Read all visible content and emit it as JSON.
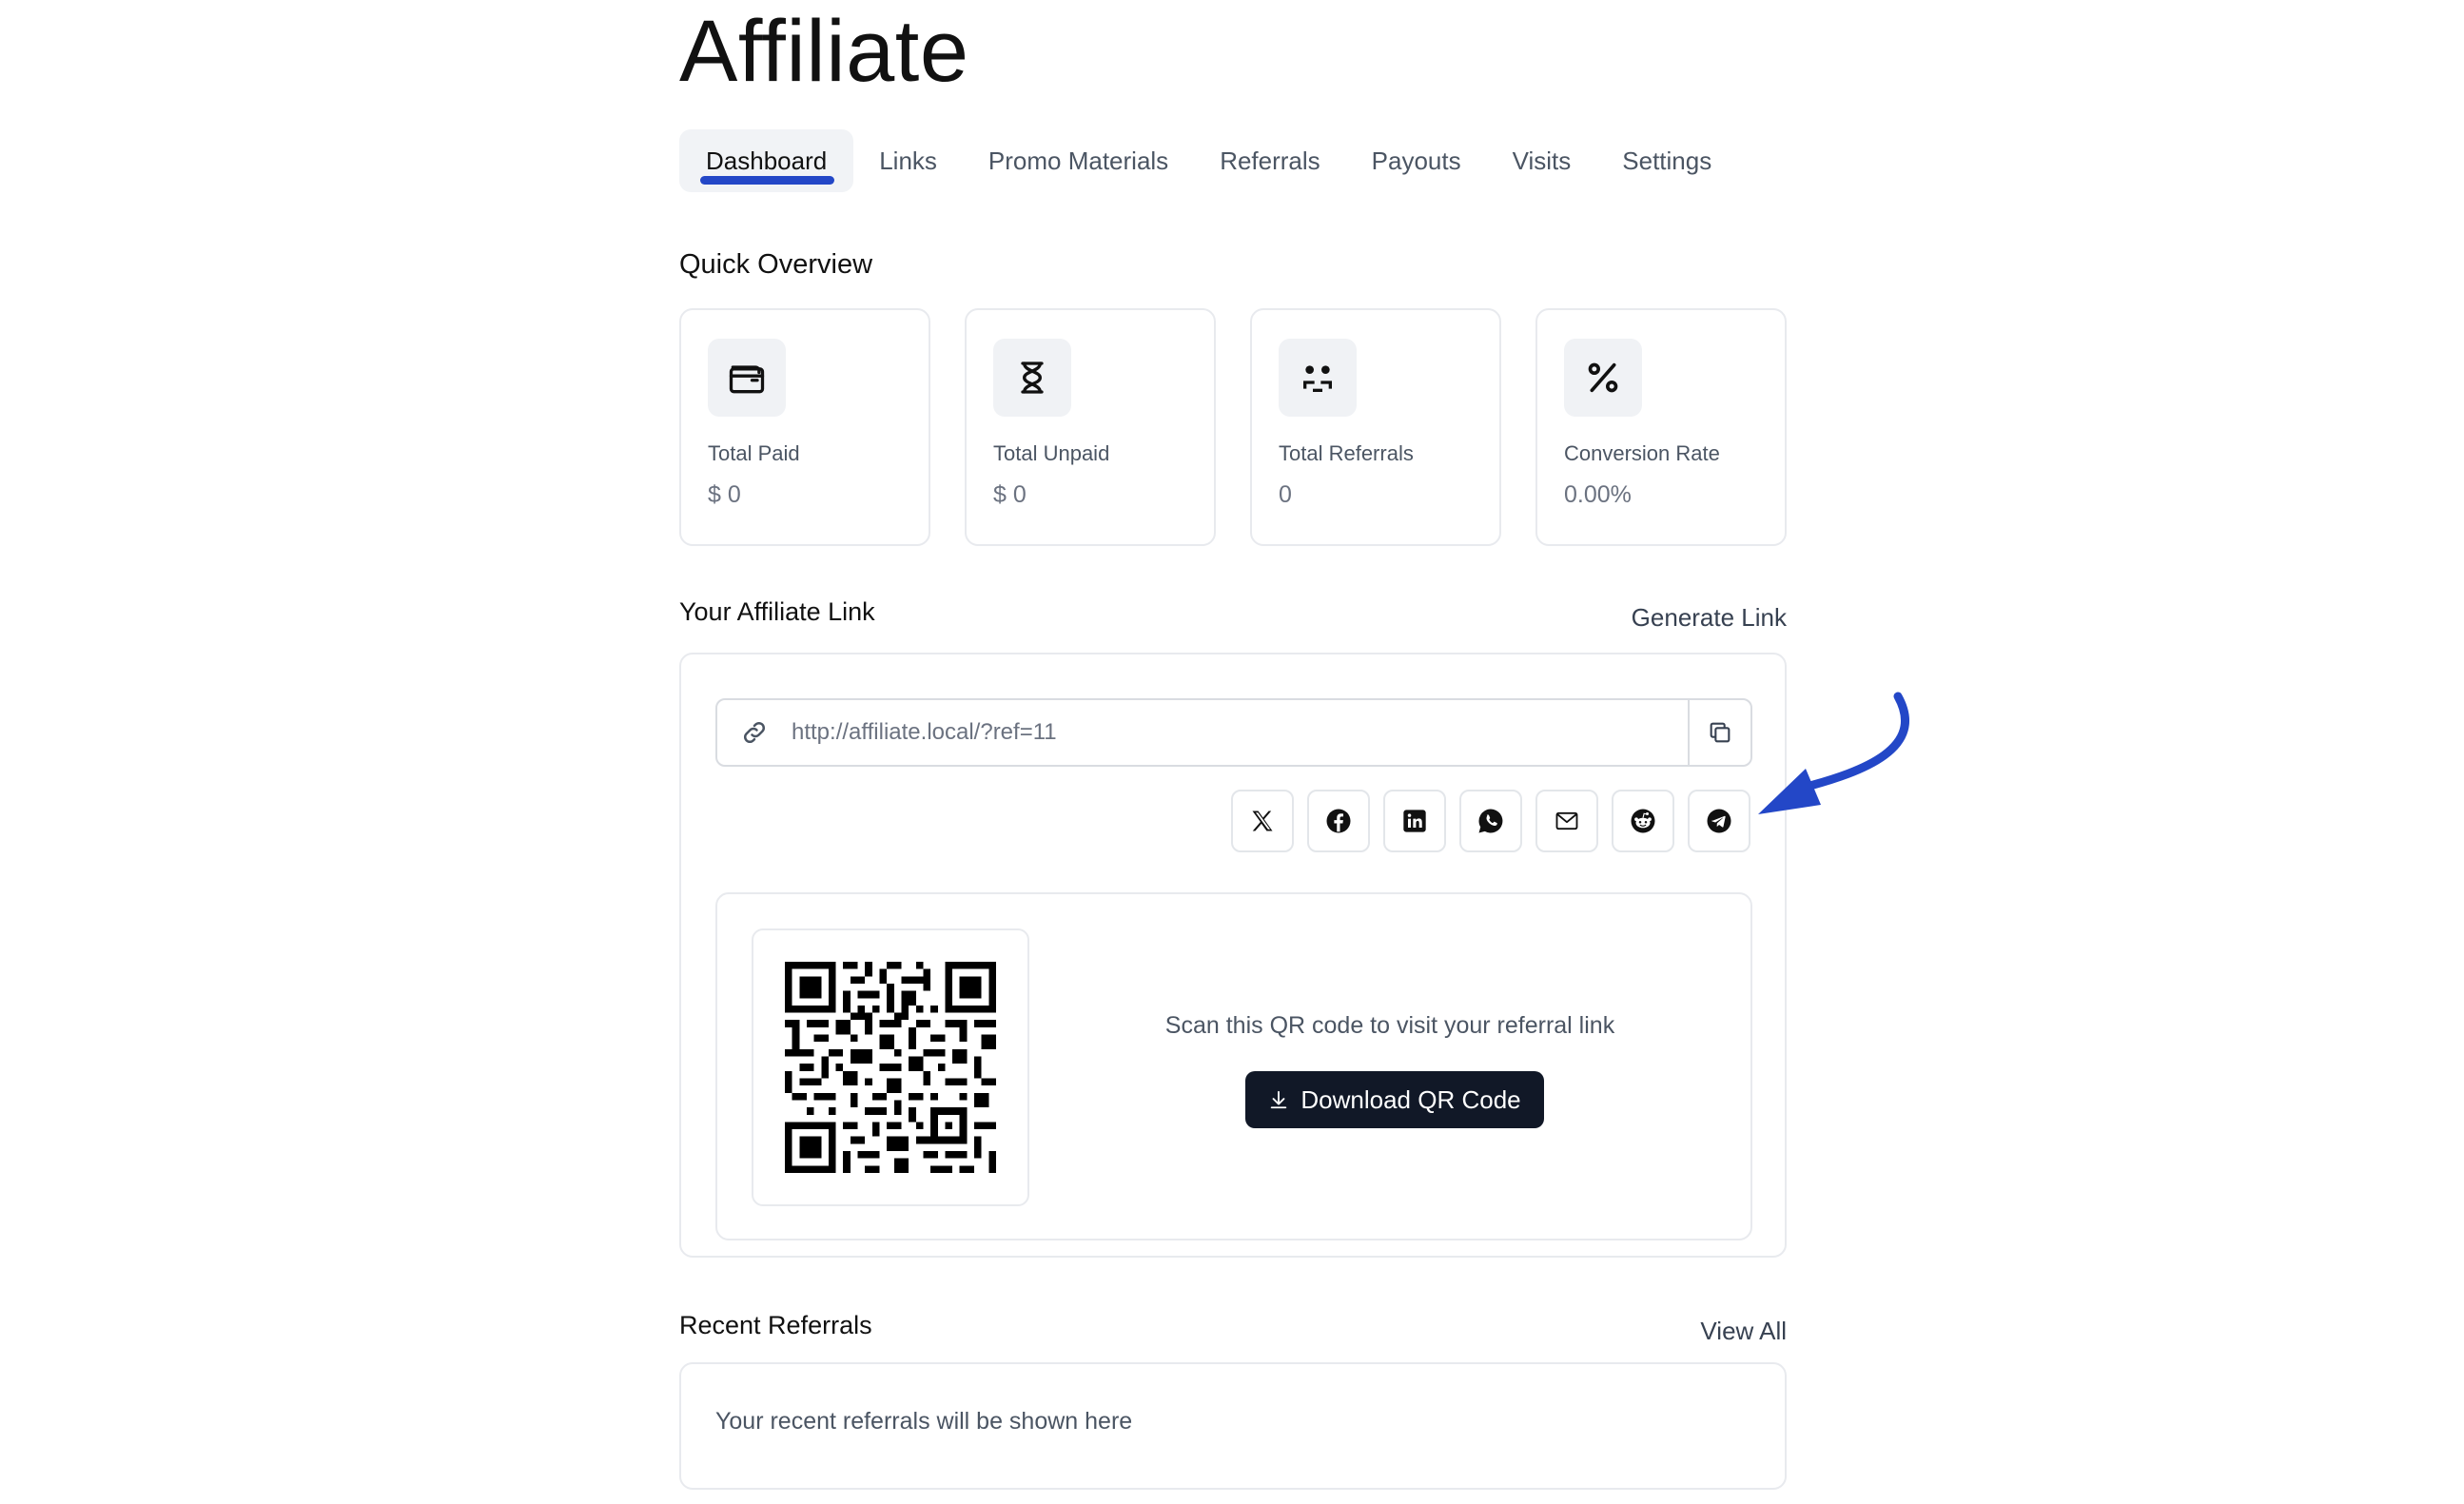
{
  "page": {
    "title": "Affiliate"
  },
  "tabs": [
    {
      "label": "Dashboard",
      "active": true
    },
    {
      "label": "Links"
    },
    {
      "label": "Promo Materials"
    },
    {
      "label": "Referrals"
    },
    {
      "label": "Payouts"
    },
    {
      "label": "Visits"
    },
    {
      "label": "Settings"
    }
  ],
  "overview": {
    "title": "Quick Overview",
    "cards": [
      {
        "icon": "wallet-icon",
        "label": "Total Paid",
        "value": "$ 0"
      },
      {
        "icon": "hourglass-icon",
        "label": "Total Unpaid",
        "value": "$ 0"
      },
      {
        "icon": "users-icon",
        "label": "Total Referrals",
        "value": "0"
      },
      {
        "icon": "percent-icon",
        "label": "Conversion Rate",
        "value": "0.00%"
      }
    ]
  },
  "affiliate_link": {
    "title": "Your Affiliate Link",
    "generate_label": "Generate Link",
    "url": "http://affiliate.local/?ref=11",
    "share_icons": [
      "x-icon",
      "facebook-icon",
      "linkedin-icon",
      "whatsapp-icon",
      "email-icon",
      "reddit-icon",
      "telegram-icon"
    ],
    "qr": {
      "caption": "Scan this QR code to visit your referral link",
      "download_label": "Download QR Code"
    }
  },
  "recent": {
    "title": "Recent Referrals",
    "view_all_label": "View All",
    "empty_text": "Your recent referrals will be shown here"
  },
  "colors": {
    "accent": "#2347c7",
    "button_dark": "#111827",
    "border": "#e8eaee",
    "annotation_arrow": "#2347c7"
  }
}
